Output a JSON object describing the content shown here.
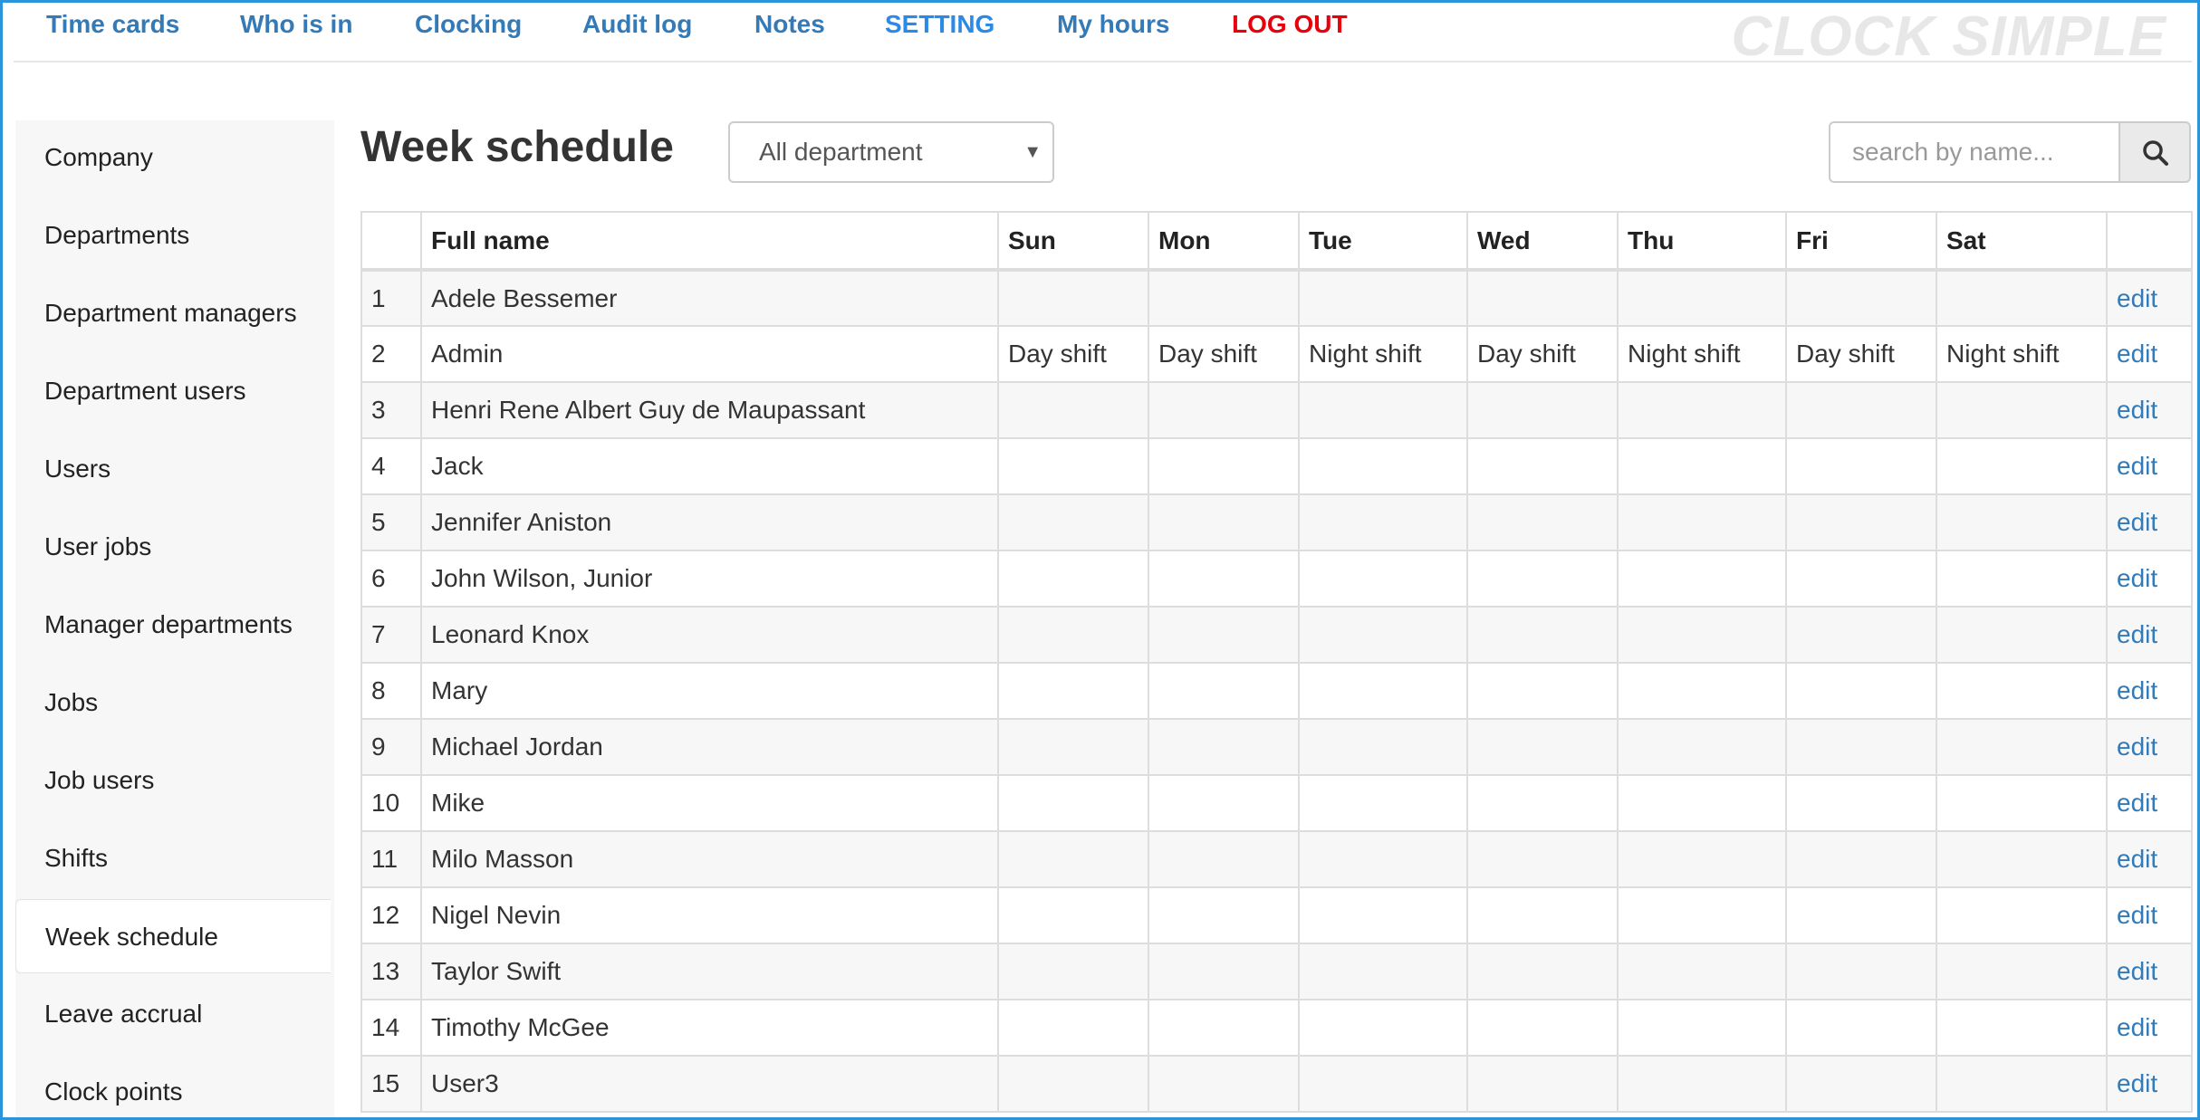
{
  "nav": {
    "items": [
      {
        "label": "Time cards"
      },
      {
        "label": "Who is in"
      },
      {
        "label": "Clocking"
      },
      {
        "label": "Audit log"
      },
      {
        "label": "Notes"
      },
      {
        "label": "SETTING"
      },
      {
        "label": "My hours"
      },
      {
        "label": "LOG OUT"
      }
    ],
    "brand": "CLOCK SIMPLE"
  },
  "sidebar": {
    "items": [
      {
        "label": "Company"
      },
      {
        "label": "Departments"
      },
      {
        "label": "Department managers"
      },
      {
        "label": "Department users"
      },
      {
        "label": "Users"
      },
      {
        "label": "User jobs"
      },
      {
        "label": "Manager departments"
      },
      {
        "label": "Jobs"
      },
      {
        "label": "Job users"
      },
      {
        "label": "Shifts"
      },
      {
        "label": "Week schedule"
      },
      {
        "label": "Leave accrual"
      },
      {
        "label": "Clock points"
      }
    ],
    "active": "Week schedule"
  },
  "main": {
    "title": "Week schedule",
    "department_select": {
      "value": "All department"
    },
    "search": {
      "placeholder": "search by name..."
    },
    "table": {
      "headers": {
        "num": "",
        "name": "Full name",
        "sun": "Sun",
        "mon": "Mon",
        "tue": "Tue",
        "wed": "Wed",
        "thu": "Thu",
        "fri": "Fri",
        "sat": "Sat",
        "action": ""
      },
      "rows": [
        {
          "num": "1",
          "name": "Adele Bessemer",
          "sun": "",
          "mon": "",
          "tue": "",
          "wed": "",
          "thu": "",
          "fri": "",
          "sat": "",
          "action": "edit"
        },
        {
          "num": "2",
          "name": "Admin",
          "sun": "Day shift",
          "mon": "Day shift",
          "tue": "Night shift",
          "wed": "Day shift",
          "thu": "Night shift",
          "fri": "Day shift",
          "sat": "Night shift",
          "action": "edit"
        },
        {
          "num": "3",
          "name": "Henri Rene Albert Guy de Maupassant",
          "sun": "",
          "mon": "",
          "tue": "",
          "wed": "",
          "thu": "",
          "fri": "",
          "sat": "",
          "action": "edit"
        },
        {
          "num": "4",
          "name": "Jack",
          "sun": "",
          "mon": "",
          "tue": "",
          "wed": "",
          "thu": "",
          "fri": "",
          "sat": "",
          "action": "edit"
        },
        {
          "num": "5",
          "name": "Jennifer Aniston",
          "sun": "",
          "mon": "",
          "tue": "",
          "wed": "",
          "thu": "",
          "fri": "",
          "sat": "",
          "action": "edit"
        },
        {
          "num": "6",
          "name": "John Wilson, Junior",
          "sun": "",
          "mon": "",
          "tue": "",
          "wed": "",
          "thu": "",
          "fri": "",
          "sat": "",
          "action": "edit"
        },
        {
          "num": "7",
          "name": "Leonard Knox",
          "sun": "",
          "mon": "",
          "tue": "",
          "wed": "",
          "thu": "",
          "fri": "",
          "sat": "",
          "action": "edit"
        },
        {
          "num": "8",
          "name": "Mary",
          "sun": "",
          "mon": "",
          "tue": "",
          "wed": "",
          "thu": "",
          "fri": "",
          "sat": "",
          "action": "edit"
        },
        {
          "num": "9",
          "name": "Michael Jordan",
          "sun": "",
          "mon": "",
          "tue": "",
          "wed": "",
          "thu": "",
          "fri": "",
          "sat": "",
          "action": "edit"
        },
        {
          "num": "10",
          "name": "Mike",
          "sun": "",
          "mon": "",
          "tue": "",
          "wed": "",
          "thu": "",
          "fri": "",
          "sat": "",
          "action": "edit"
        },
        {
          "num": "11",
          "name": "Milo Masson",
          "sun": "",
          "mon": "",
          "tue": "",
          "wed": "",
          "thu": "",
          "fri": "",
          "sat": "",
          "action": "edit"
        },
        {
          "num": "12",
          "name": "Nigel Nevin",
          "sun": "",
          "mon": "",
          "tue": "",
          "wed": "",
          "thu": "",
          "fri": "",
          "sat": "",
          "action": "edit"
        },
        {
          "num": "13",
          "name": "Taylor Swift",
          "sun": "",
          "mon": "",
          "tue": "",
          "wed": "",
          "thu": "",
          "fri": "",
          "sat": "",
          "action": "edit"
        },
        {
          "num": "14",
          "name": "Timothy McGee",
          "sun": "",
          "mon": "",
          "tue": "",
          "wed": "",
          "thu": "",
          "fri": "",
          "sat": "",
          "action": "edit"
        },
        {
          "num": "15",
          "name": "User3",
          "sun": "",
          "mon": "",
          "tue": "",
          "wed": "",
          "thu": "",
          "fri": "",
          "sat": "",
          "action": "edit"
        }
      ]
    }
  },
  "colors": {
    "nav_link": "#337ab7",
    "nav_link_highlight": "#2a8ae6",
    "logout": "#e8000b",
    "frame_border": "#2b95dc",
    "brand_watermark": "#e7e7e7"
  },
  "icons": {
    "search": "search-icon",
    "select_caret": "caret-down-icon"
  }
}
